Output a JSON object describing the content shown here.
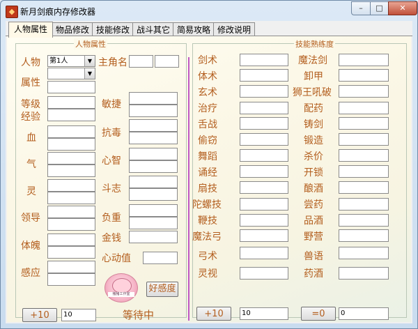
{
  "window": {
    "title": "新月剑痕内存修改器",
    "controls": {
      "minimize": "–",
      "maximize": "□",
      "close": "✕"
    }
  },
  "tabs": [
    {
      "label": "人物属性",
      "active": true
    },
    {
      "label": "物品修改",
      "active": false
    },
    {
      "label": "技能修改",
      "active": false
    },
    {
      "label": "战斗其它",
      "active": false
    },
    {
      "label": "简易攻略",
      "active": false
    },
    {
      "label": "修改说明",
      "active": false
    }
  ],
  "character": {
    "group_title": "人物属性",
    "labels": {
      "person": "人物",
      "attribute": "属性",
      "level": "等级",
      "exp": "经验",
      "hp": "血",
      "qi": "气",
      "spirit": "灵",
      "leadership": "领导",
      "physique": "体魄",
      "perception": "感应",
      "main_name": "主角名",
      "agility": "敏捷",
      "poison_resist": "抗毒",
      "intellect": "心智",
      "fighting_will": "斗志",
      "load": "负重",
      "money": "金钱",
      "affection": "心动值"
    },
    "person_select": "第1人",
    "attribute_select": "",
    "plus_button": "+10",
    "plus_value": "10",
    "favor_button": "好感度",
    "status": "等待中",
    "logo_caption": "猪猪工作室"
  },
  "skills": {
    "group_title": "技能熟练度",
    "left": [
      "剑术",
      "体术",
      "玄术",
      "治疗",
      "舌战",
      "偷窃",
      "舞蹈",
      "诵经",
      "扇技",
      "陀螺技",
      "鞭技",
      "魔法弓",
      "弓术",
      "灵视"
    ],
    "right": [
      "魔法剑",
      "卸甲",
      "狮王吼破",
      "配药",
      "铸剑",
      "锻造",
      "杀价",
      "开锁",
      "酿酒",
      "尝药",
      "品酒",
      "野营",
      "兽语",
      "药酒"
    ],
    "plus_button": "+10",
    "plus_value": "10",
    "zero_button": "=0",
    "zero_value": "0"
  },
  "colors": {
    "label": "#b35e1e",
    "divider": "#c058c4",
    "panel": "#fcf9ea"
  }
}
